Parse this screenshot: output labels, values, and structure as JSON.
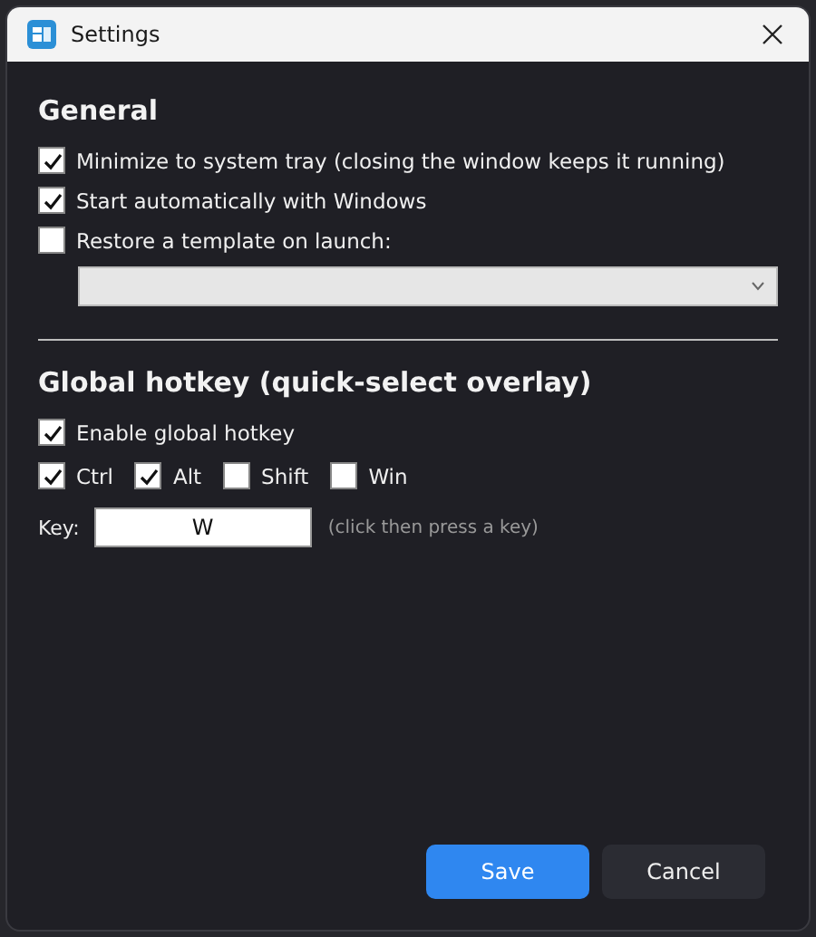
{
  "window": {
    "title": "Settings"
  },
  "general": {
    "heading": "General",
    "options": [
      {
        "label": "Minimize to system tray (closing the window keeps it running)",
        "checked": true
      },
      {
        "label": "Start automatically with Windows",
        "checked": true
      },
      {
        "label": "Restore a template on launch:",
        "checked": false
      }
    ]
  },
  "hotkey": {
    "heading": "Global hotkey (quick-select overlay)",
    "enable": {
      "label": "Enable global hotkey",
      "checked": true
    },
    "modifiers": [
      {
        "label": "Ctrl",
        "checked": true
      },
      {
        "label": "Alt",
        "checked": true
      },
      {
        "label": "Shift",
        "checked": false
      },
      {
        "label": "Win",
        "checked": false
      }
    ],
    "key_label": "Key:",
    "key_value": "W",
    "key_hint": "(click then press a key)"
  },
  "buttons": [
    {
      "label": "Save",
      "kind": "primary"
    },
    {
      "label": "Cancel",
      "kind": "secondary"
    }
  ]
}
